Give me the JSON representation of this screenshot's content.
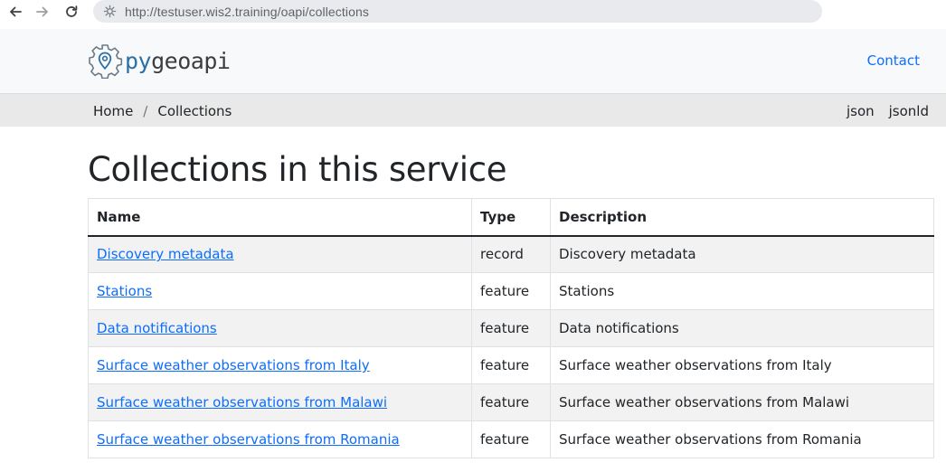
{
  "browser": {
    "url": "http://testuser.wis2.training/oapi/collections",
    "icons": {
      "back": "arrow-left-icon",
      "forward": "arrow-right-icon",
      "reload": "reload-icon",
      "site": "site-settings-icon"
    }
  },
  "navbar": {
    "logo_py": "py",
    "logo_geo": "geoapi",
    "contact_label": "Contact",
    "brand_color": "#2b6fa6",
    "link_color": "#0d6efd"
  },
  "breadcrumb": {
    "home_label": "Home",
    "separator": "/",
    "current_label": "Collections"
  },
  "formats": {
    "json_label": "json",
    "jsonld_label": "jsonld"
  },
  "main": {
    "title": "Collections in this service",
    "table": {
      "headers": [
        "Name",
        "Type",
        "Description"
      ],
      "rows": [
        {
          "name": "Discovery metadata",
          "type": "record",
          "description": "Discovery metadata"
        },
        {
          "name": "Stations",
          "type": "feature",
          "description": "Stations"
        },
        {
          "name": "Data notifications",
          "type": "feature",
          "description": "Data notifications"
        },
        {
          "name": "Surface weather observations from Italy",
          "type": "feature",
          "description": "Surface weather observations from Italy"
        },
        {
          "name": "Surface weather observations from Malawi",
          "type": "feature",
          "description": "Surface weather observations from Malawi"
        },
        {
          "name": "Surface weather observations from Romania",
          "type": "feature",
          "description": "Surface weather observations from Romania"
        }
      ]
    }
  }
}
